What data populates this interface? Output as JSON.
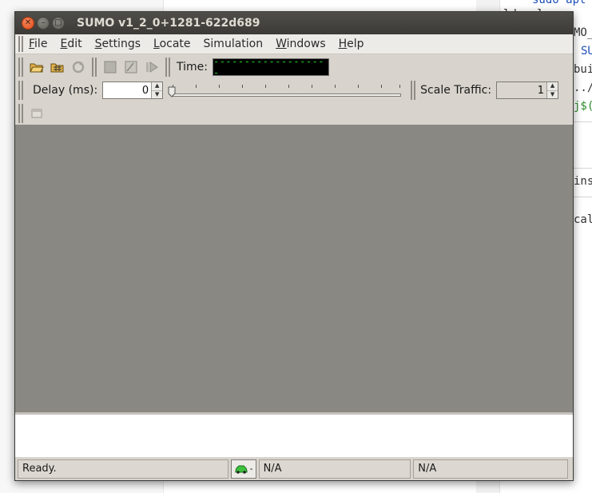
{
  "window": {
    "title": "SUMO v1_2_0+1281-622d689"
  },
  "menu": {
    "items": [
      {
        "accel": "F",
        "rest": "ile"
      },
      {
        "accel": "E",
        "rest": "dit"
      },
      {
        "accel": "S",
        "rest": "ettings"
      },
      {
        "accel": "L",
        "rest": "ocate"
      },
      {
        "accel": "",
        "rest": "Simulation"
      },
      {
        "accel": "W",
        "rest": "indows"
      },
      {
        "accel": "H",
        "rest": "elp"
      }
    ]
  },
  "toolbar": {
    "time_label": "Time:",
    "time_display": "-------------------",
    "icons": [
      "open-simulation-icon",
      "open-network-icon",
      "reload-icon",
      "stop-icon",
      "step-icon",
      "run-icon"
    ]
  },
  "delay": {
    "label": "Delay (ms):",
    "value": "0"
  },
  "scale": {
    "label": "Scale Traffic:",
    "value": "1"
  },
  "status": {
    "message": "Ready.",
    "car_text": "-",
    "cell_2": "N/A",
    "cell_3": "N/A"
  },
  "background_code": {
    "lines": [
      "sudo apt",
      "ldev l",
      "MO_",
      "SU",
      "bui",
      "../",
      "j$(",
      "ins",
      "cal"
    ]
  },
  "colors": {
    "lcd_text": "#2ad42a",
    "mdi_background": "#898883",
    "close_button": "#df4a16"
  }
}
